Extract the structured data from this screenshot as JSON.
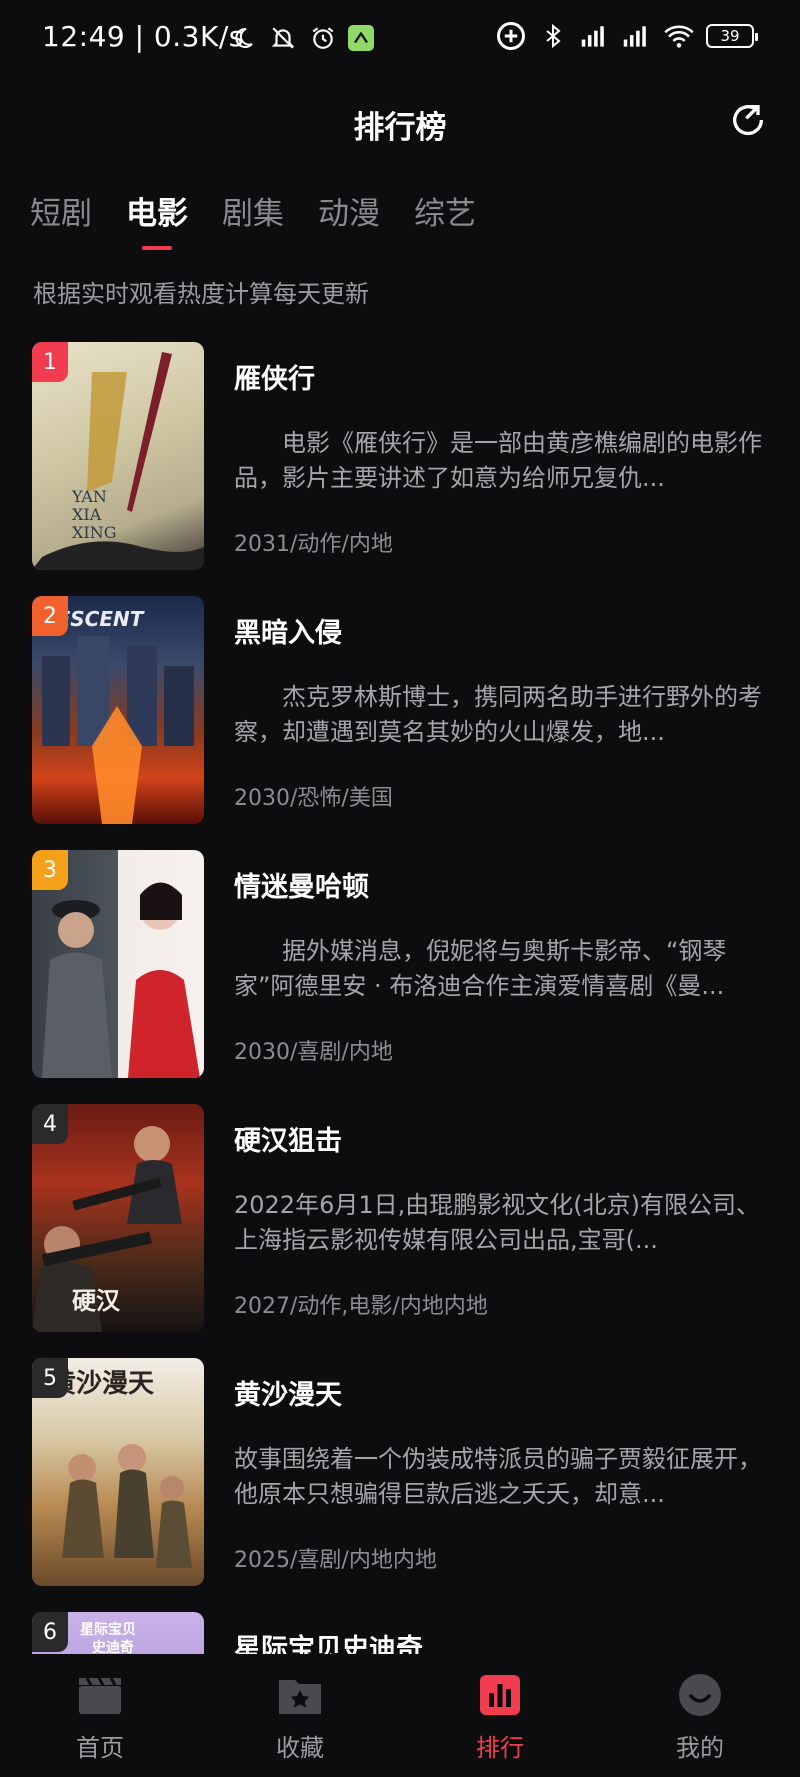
{
  "status_bar": {
    "time": "12:49 | 0.3K/s",
    "battery": "39"
  },
  "header": {
    "title": "排行榜"
  },
  "tabs": [
    {
      "label": "短剧"
    },
    {
      "label": "电影"
    },
    {
      "label": "剧集"
    },
    {
      "label": "动漫"
    },
    {
      "label": "综艺"
    }
  ],
  "active_tab": "电影",
  "subtitle": "根据实时观看热度计算每天更新",
  "items": [
    {
      "rank": "1",
      "rank_color": "#f23c50",
      "title": "雁侠行",
      "description": "电影《雁侠行》是一部由黄彦樵编剧的电影作品，影片主要讲述了如意为给师兄复仇...",
      "meta": "2031/动作/内地"
    },
    {
      "rank": "2",
      "rank_color": "#f0612f",
      "title": "黑暗入侵",
      "description": "杰克罗林斯博士，携同两名助手进行野外的考察，却遭遇到莫名其妙的火山爆发，地...",
      "meta": "2030/恐怖/美国"
    },
    {
      "rank": "3",
      "rank_color": "#f5a019",
      "title": "情迷曼哈顿",
      "description": "据外媒消息，倪妮将与奥斯卡影帝、“钢琴家”阿德里安 · 布洛迪合作主演爱情喜剧《曼...",
      "meta": "2030/喜剧/内地"
    },
    {
      "rank": "4",
      "rank_color": "#2a2a2d",
      "title": "硬汉狙击",
      "description": "2022年6月1日,由琨鹏影视文化(北京)有限公司、上海指云影视传媒有限公司出品,宝哥(...",
      "meta": "2027/动作,电影/内地内地"
    },
    {
      "rank": "5",
      "rank_color": "#2a2a2d",
      "title": "黄沙漫天",
      "description": "故事围绕着一个伪装成特派员的骗子贾毅征展开，他原本只想骗得巨款后逃之夭夭，却意...",
      "meta": "2025/喜剧/内地内地"
    },
    {
      "rank": "6",
      "rank_color": "#2a2a2d",
      "title": "星际宝贝史迪奇",
      "description": "",
      "meta": ""
    }
  ],
  "bottom_nav": [
    {
      "label": "首页"
    },
    {
      "label": "收藏"
    },
    {
      "label": "排行"
    },
    {
      "label": "我的"
    }
  ],
  "active_nav": "排行",
  "colors": {
    "accent": "#f23c50",
    "background": "#0d0d0f"
  }
}
